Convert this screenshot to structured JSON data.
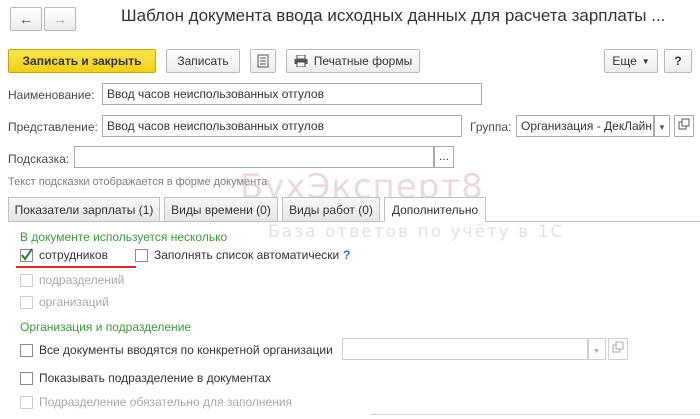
{
  "window": {
    "title": "Шаблон документа ввода исходных данных для расчета зарплаты ..."
  },
  "toolbar": {
    "save_close_label": "Записать и закрыть",
    "save_label": "Записать",
    "print_forms_label": "Печатные формы",
    "more_label": "Еще",
    "help_label": "?"
  },
  "form": {
    "name_label": "Наименование:",
    "name_value": "Ввод часов неиспользованных отгулов",
    "representation_label": "Представление:",
    "representation_value": "Ввод часов неиспользованных отгулов",
    "group_label": "Группа:",
    "group_value": "Организация - ДекЛайн",
    "tooltip_label": "Подсказка:",
    "tooltip_value": "",
    "tooltip_button": "...",
    "tooltip_hint": "Текст подсказки отображается в форме документа"
  },
  "tabs": [
    {
      "label": "Показатели зарплаты (1)"
    },
    {
      "label": "Виды времени (0)"
    },
    {
      "label": "Виды работ (0)"
    },
    {
      "label": "Дополнительно"
    }
  ],
  "additional": {
    "section_used": "В документе используется несколько",
    "employees": {
      "label": "сотрудников",
      "checked": true
    },
    "fill_auto": {
      "label": "Заполнять список автоматически",
      "checked": false,
      "help": "?"
    },
    "departments": {
      "label": "подразделений",
      "checked": false
    },
    "organizations": {
      "label": "организаций",
      "checked": false
    },
    "section_org": "Организация и подразделение",
    "specific_org": {
      "label": "Все документы вводятся по конкретной организации",
      "checked": false,
      "value": ""
    },
    "show_department": {
      "label": "Показывать подразделение в документах",
      "checked": false
    },
    "department_required": {
      "label": "Подразделение обязательно для заполнения",
      "checked": false
    }
  },
  "watermark": {
    "brand": "БухЭксперт8",
    "tagline": "База ответов по учёту в 1С"
  },
  "colors": {
    "primary_button": "#f5d524",
    "section_text": "#3c9a3c",
    "highlight_underline": "#d62b2b",
    "checkmark": "#2f7a2f"
  }
}
